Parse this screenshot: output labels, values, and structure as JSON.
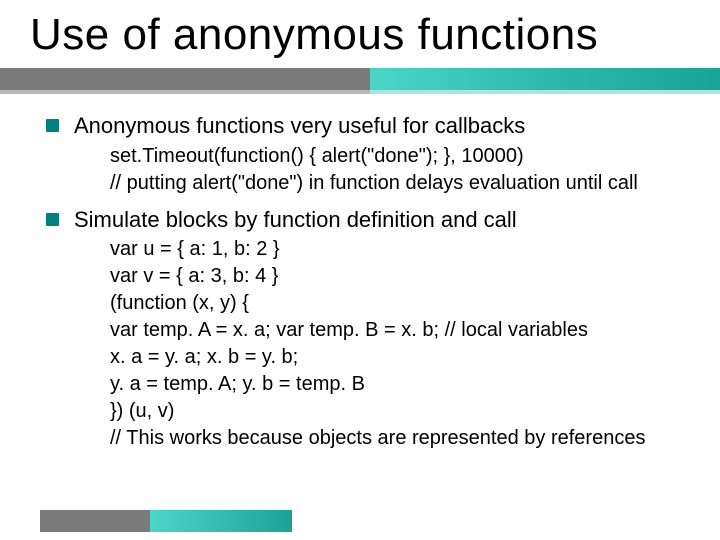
{
  "title": "Use of anonymous functions",
  "bullets": [
    {
      "text": "Anonymous functions very useful for callbacks",
      "subs": [
        "set.Timeout(function() { alert(\"done\"); }, 10000)",
        "// putting alert(\"done\") in function delays evaluation until call"
      ]
    },
    {
      "text": "Simulate blocks by function definition and call",
      "subs": [
        "var u = { a: 1, b: 2 }",
        "var v = { a: 3, b: 4 }",
        "(function (x, y) {",
        "        var temp. A = x. a; var temp. B = x. b;  // local variables",
        "        x. a = y. a; x. b = y. b;",
        "        y. a = temp. A; y. b = temp. B",
        "}) (u, v)",
        "// This works because objects are represented by references"
      ]
    }
  ]
}
